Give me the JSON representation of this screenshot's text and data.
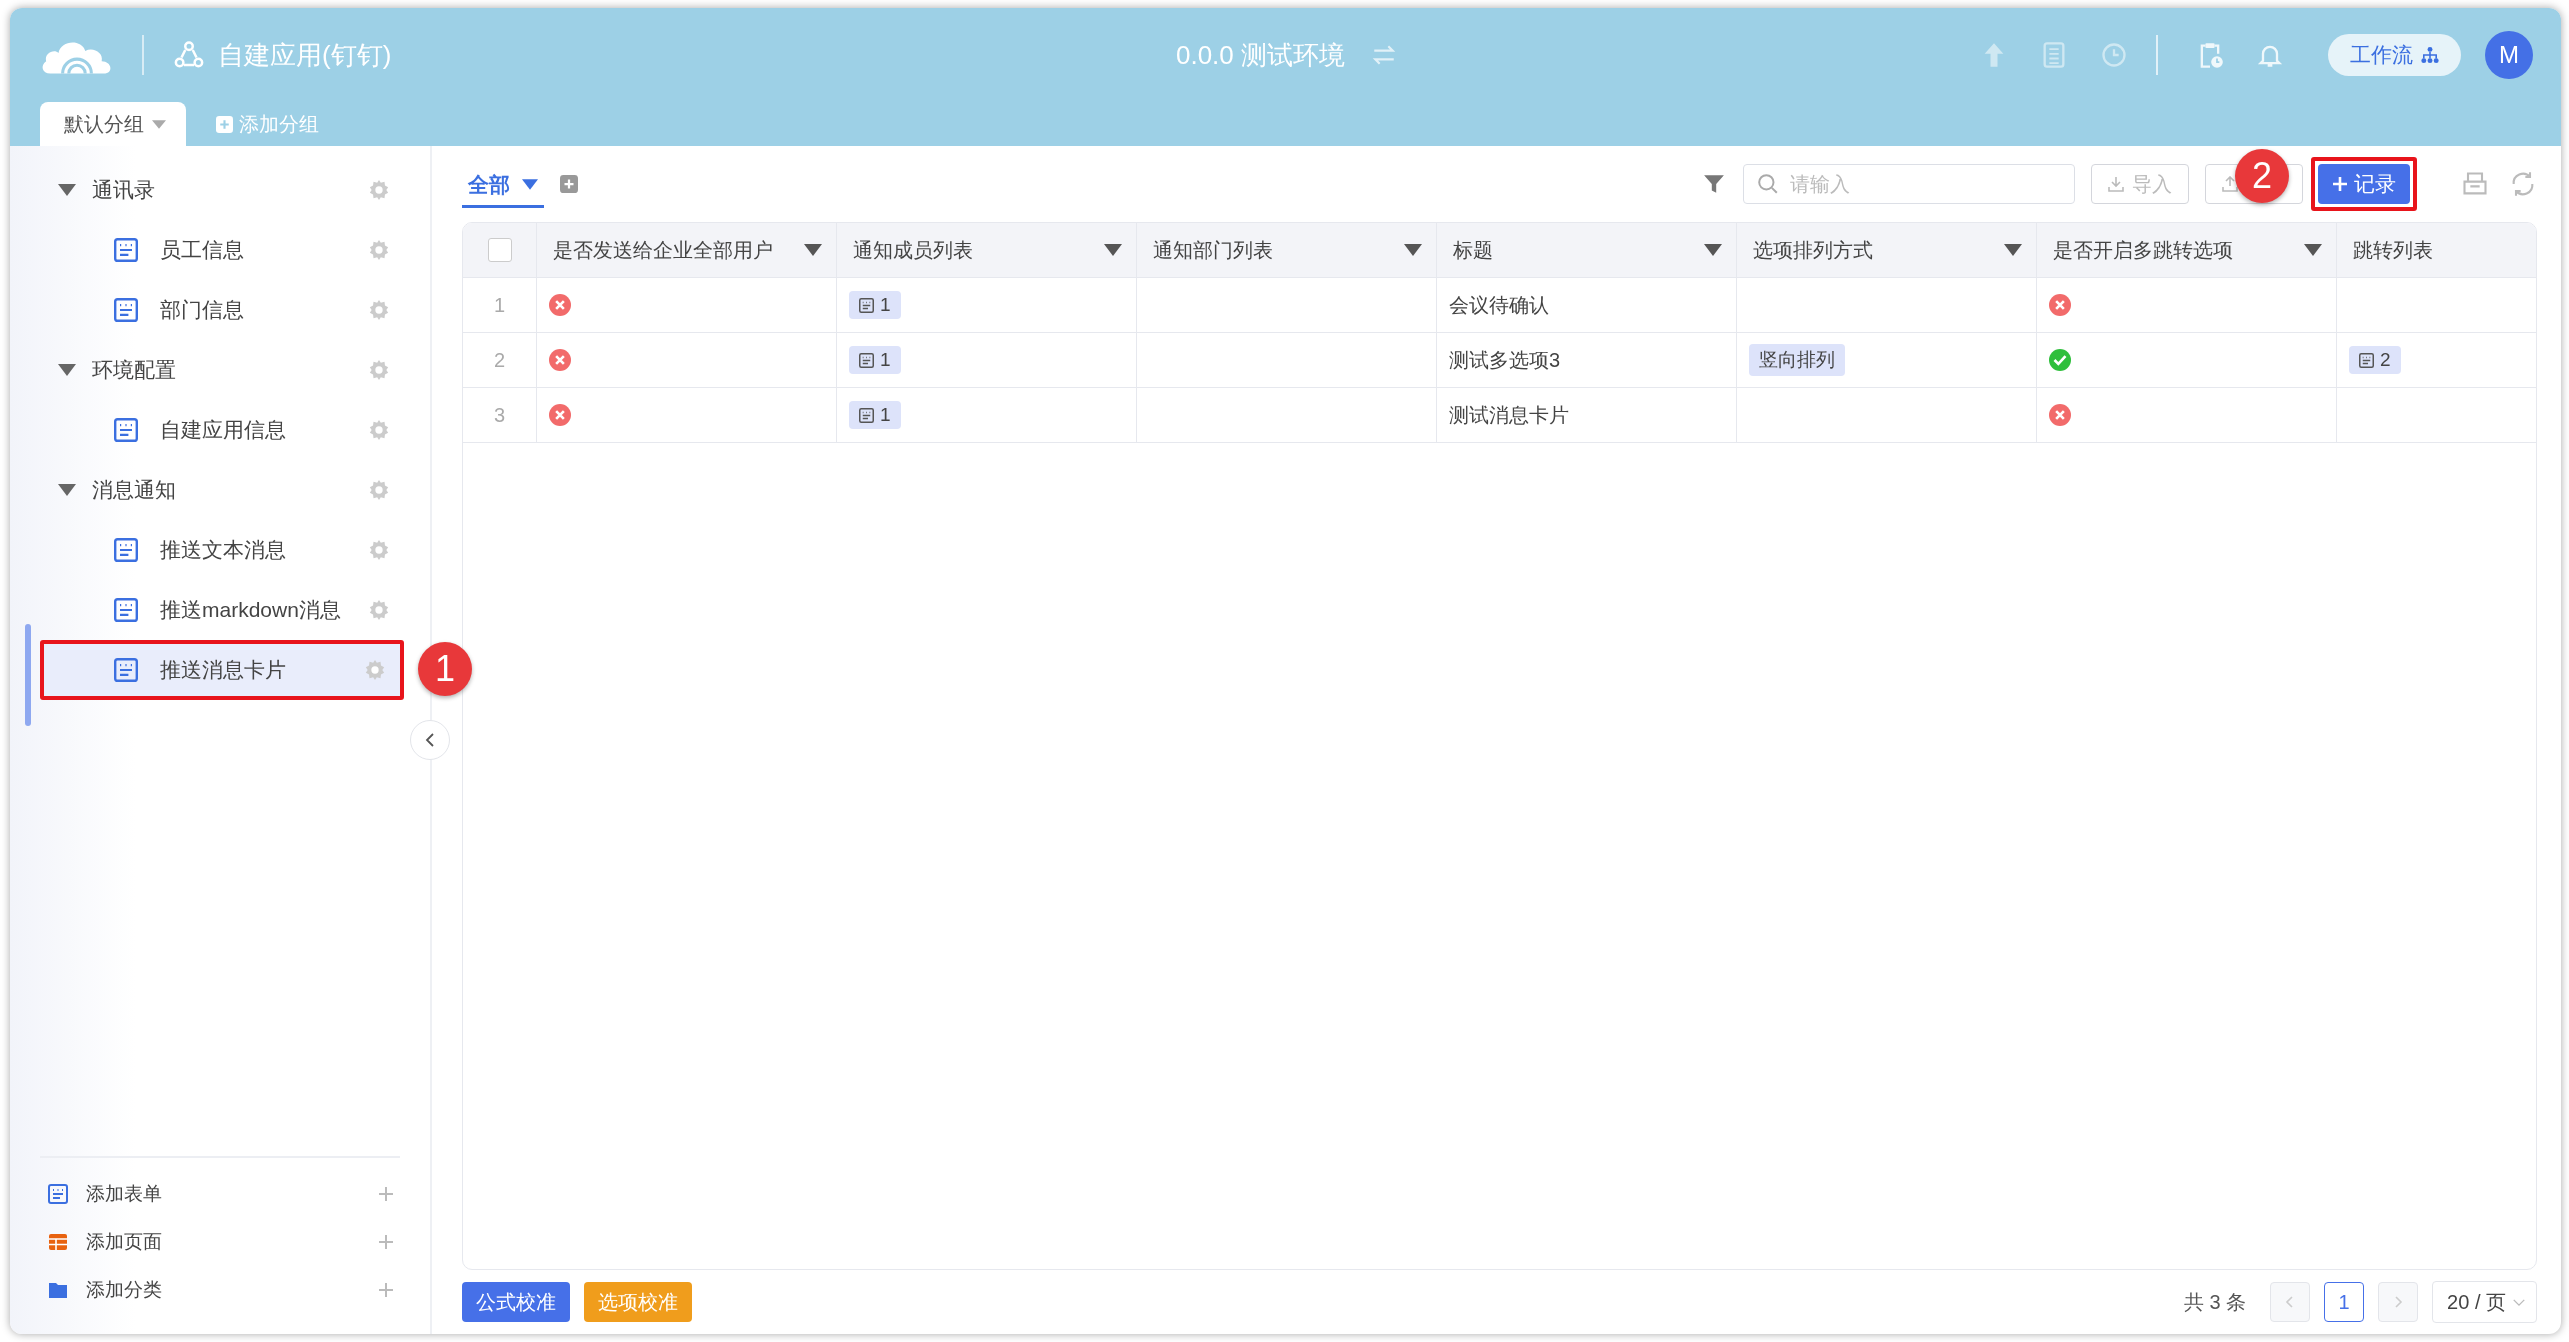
{
  "header": {
    "app_title": "自建应用(钉钉)",
    "environment": "0.0.0 测试环境",
    "workflow_button": "工作流",
    "avatar": "M"
  },
  "group_tabs": [
    {
      "label": "默认分组",
      "selected": true
    }
  ],
  "add_group": "添加分组",
  "sidebar": {
    "tree": [
      {
        "label": "通讯录",
        "expanded": true,
        "children": [
          {
            "label": "员工信息",
            "selected": false
          },
          {
            "label": "部门信息",
            "selected": false
          }
        ]
      },
      {
        "label": "环境配置",
        "expanded": true,
        "children": [
          {
            "label": "自建应用信息",
            "selected": false
          }
        ]
      },
      {
        "label": "消息通知",
        "expanded": true,
        "children": [
          {
            "label": "推送文本消息",
            "selected": false
          },
          {
            "label": "推送markdown消息",
            "selected": false
          },
          {
            "label": "推送消息卡片",
            "selected": true,
            "callout": "1"
          }
        ]
      }
    ],
    "footer_items": [
      {
        "label": "添加表单",
        "kind": "form"
      },
      {
        "label": "添加页面",
        "kind": "page"
      },
      {
        "label": "添加分类",
        "kind": "folder"
      }
    ]
  },
  "toolbar": {
    "view_tab": {
      "label": "全部",
      "selected": true
    },
    "search": {
      "placeholder": "请输入"
    },
    "import_button": "导入",
    "add_record_button": {
      "label": "记录",
      "callout": "2"
    }
  },
  "table": {
    "header_checkbox": {
      "checked": false
    },
    "columns": [
      {
        "label": "是否发送给企业全部用户",
        "dropdown": true
      },
      {
        "label": "通知成员列表",
        "dropdown": true
      },
      {
        "label": "通知部门列表",
        "dropdown": true
      },
      {
        "label": "标题",
        "dropdown": true
      },
      {
        "label": "选项排列方式",
        "dropdown": true
      },
      {
        "label": "是否开启多跳转选项",
        "dropdown": true
      },
      {
        "label": "跳转列表",
        "dropdown": false
      }
    ],
    "rows": [
      {
        "index": "1",
        "cells": [
          {
            "kind": "bool",
            "value": false
          },
          {
            "kind": "record",
            "text": "1"
          },
          {
            "kind": "empty"
          },
          {
            "kind": "text",
            "text": "会议待确认"
          },
          {
            "kind": "empty"
          },
          {
            "kind": "bool",
            "value": false
          },
          {
            "kind": "empty"
          }
        ]
      },
      {
        "index": "2",
        "cells": [
          {
            "kind": "bool",
            "value": false
          },
          {
            "kind": "record",
            "text": "1"
          },
          {
            "kind": "empty"
          },
          {
            "kind": "text",
            "text": "测试多选项3"
          },
          {
            "kind": "option",
            "text": "竖向排列"
          },
          {
            "kind": "bool",
            "value": true
          },
          {
            "kind": "record",
            "text": "2"
          }
        ]
      },
      {
        "index": "3",
        "cells": [
          {
            "kind": "bool",
            "value": false
          },
          {
            "kind": "record",
            "text": "1"
          },
          {
            "kind": "empty"
          },
          {
            "kind": "text",
            "text": "测试消息卡片"
          },
          {
            "kind": "empty"
          },
          {
            "kind": "bool",
            "value": false
          },
          {
            "kind": "empty"
          }
        ]
      }
    ]
  },
  "footer": {
    "buttons": [
      {
        "label": "公式校准",
        "kind": "primary"
      },
      {
        "label": "选项校准",
        "kind": "warning"
      }
    ],
    "total": "共 3 条",
    "pages": [
      {
        "label": "1",
        "selected": true
      }
    ],
    "page_size": "20 / 页"
  }
}
